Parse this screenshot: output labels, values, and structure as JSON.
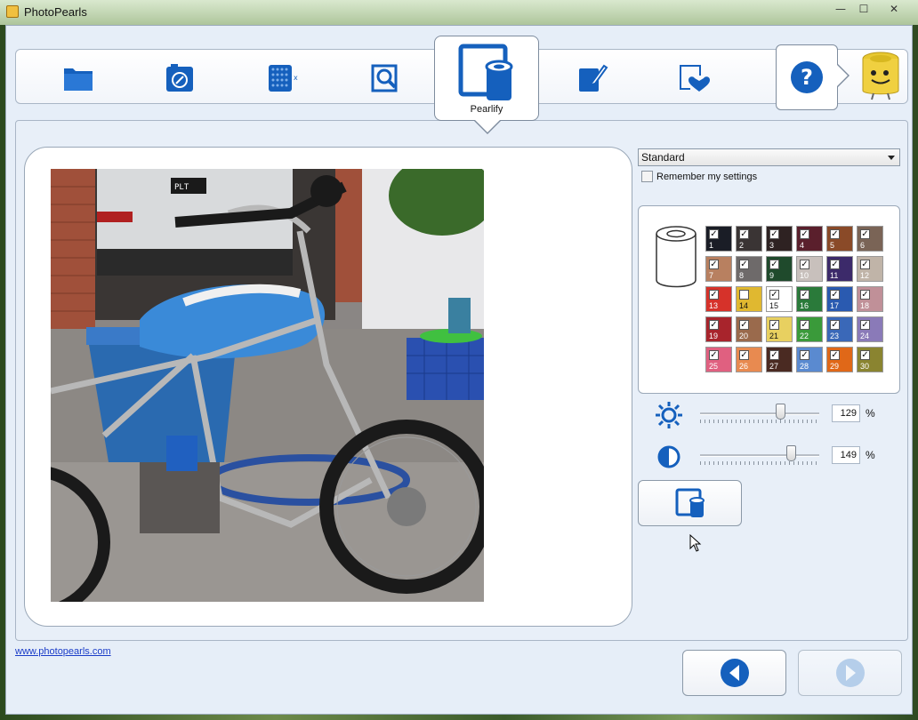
{
  "window": {
    "title": "PhotoPearls",
    "controls": {
      "minimize": "—",
      "maximize": "☐",
      "close": "✕"
    }
  },
  "toolbar": {
    "tools": [
      {
        "name": "open-folder-icon"
      },
      {
        "name": "camera-icon"
      },
      {
        "name": "grid-size-icon"
      },
      {
        "name": "zoom-crop-icon"
      },
      {
        "name": "pearlify-icon",
        "label": "Pearlify",
        "active": true
      },
      {
        "name": "edit-pen-icon"
      },
      {
        "name": "favorite-heart-icon"
      }
    ],
    "help_symbol": "?"
  },
  "settings": {
    "preset": "Standard",
    "remember_label": "Remember my settings",
    "remember_checked": false
  },
  "palette": {
    "colors": [
      {
        "n": "1",
        "c": "#1a1d26",
        "t": "#fff"
      },
      {
        "n": "2",
        "c": "#3a3434",
        "t": "#fff"
      },
      {
        "n": "3",
        "c": "#2e2222",
        "t": "#fff"
      },
      {
        "n": "4",
        "c": "#5a1f2c",
        "t": "#fff"
      },
      {
        "n": "5",
        "c": "#8a4a28",
        "t": "#fff"
      },
      {
        "n": "6",
        "c": "#7a6456",
        "t": "#fff"
      },
      {
        "n": "7",
        "c": "#b88060",
        "t": "#fff"
      },
      {
        "n": "8",
        "c": "#6e6a6a",
        "t": "#fff"
      },
      {
        "n": "9",
        "c": "#1f4a2c",
        "t": "#fff"
      },
      {
        "n": "10",
        "c": "#c8c0bc",
        "t": "#fff"
      },
      {
        "n": "11",
        "c": "#3c2a6a",
        "t": "#fff"
      },
      {
        "n": "12",
        "c": "#c0b4a8",
        "t": "#fff"
      },
      {
        "n": "13",
        "c": "#d6322a",
        "t": "#fff"
      },
      {
        "n": "14",
        "c": "#e0b830",
        "t": "#111"
      },
      {
        "n": "15",
        "c": "#ffffff",
        "t": "#111"
      },
      {
        "n": "16",
        "c": "#2a7a3a",
        "t": "#fff"
      },
      {
        "n": "17",
        "c": "#2a5ab0",
        "t": "#fff"
      },
      {
        "n": "18",
        "c": "#c09098",
        "t": "#fff"
      },
      {
        "n": "19",
        "c": "#a8242c",
        "t": "#fff"
      },
      {
        "n": "20",
        "c": "#9a6a4c",
        "t": "#fff"
      },
      {
        "n": "21",
        "c": "#e8d060",
        "t": "#111"
      },
      {
        "n": "22",
        "c": "#3a9a3a",
        "t": "#fff"
      },
      {
        "n": "23",
        "c": "#3a68b8",
        "t": "#fff"
      },
      {
        "n": "24",
        "c": "#8a7ab8",
        "t": "#fff"
      },
      {
        "n": "25",
        "c": "#e06080",
        "t": "#fff"
      },
      {
        "n": "26",
        "c": "#e88a50",
        "t": "#fff"
      },
      {
        "n": "27",
        "c": "#4a2a22",
        "t": "#fff"
      },
      {
        "n": "28",
        "c": "#5a8ad0",
        "t": "#fff"
      },
      {
        "n": "29",
        "c": "#e06818",
        "t": "#fff"
      },
      {
        "n": "30",
        "c": "#8a8430",
        "t": "#fff"
      }
    ],
    "unchecked": [
      "14"
    ]
  },
  "brightness": {
    "value": "129",
    "unit": "%",
    "level": 0.67
  },
  "contrast": {
    "value": "149",
    "unit": "%",
    "level": 0.76
  },
  "footer": {
    "link": "www.photopearls.com"
  },
  "colors": {
    "accent": "#1560bd",
    "client_bg": "#e6eef8"
  }
}
